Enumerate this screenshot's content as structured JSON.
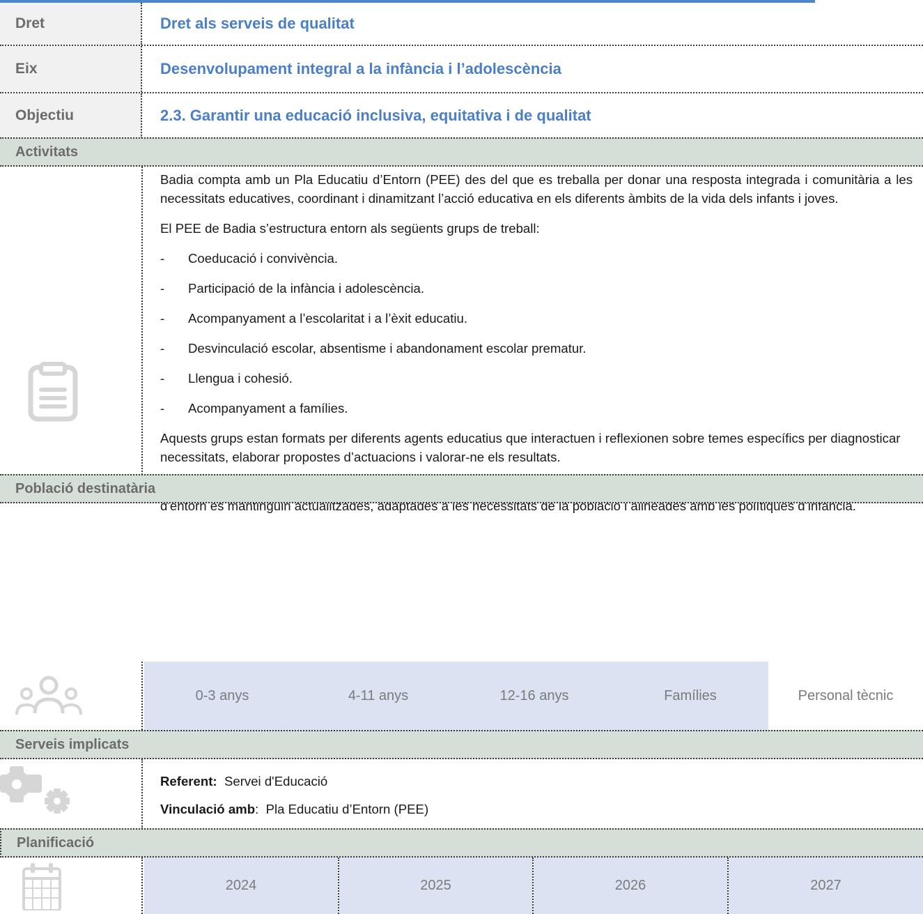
{
  "header": {
    "dret_label": "Dret",
    "dret_value": "Dret als serveis de qualitat",
    "eix_label": "Eix",
    "eix_value": "Desenvolupament integral a la infància i l’adolescència",
    "objectiu_label": "Objectiu",
    "objectiu_value": "2.3. Garantir una educació inclusiva, equitativa i de qualitat"
  },
  "activitats": {
    "title": "Activitats",
    "icon": "clipboard-icon",
    "intro": "Badia compta amb un Pla Educatiu d’Entorn (PEE) des del que es treballa per donar una resposta integrada i comunitària a les necessitats educatives, coordinant i dinamitzant l’acció educativa en els diferents àmbits de la vida dels infants i joves.",
    "groups_intro": "El PEE de Badia s’estructura entorn als següents grups de treball:",
    "groups": [
      "Coeducació i convivència.",
      "Participació de la infància i adolescència.",
      "Acompanyament a l’escolaritat i a l’èxit educatiu.",
      "Desvinculació escolar, absentisme i abandonament escolar prematur.",
      "Llengua i cohesió.",
      "Acompanyament a famílies."
    ],
    "para2": "Aquests grups estan formats per diferents agents educatius que interactuen i reflexionen sobre temes específics per diagnosticar necessitats, elaborar propostes d’actuacions i valorar-ne els resultats.",
    "para3": "Amb aquesta acció del PLIA es coordina amb el PEE per tal d’assegurar que les accions i estratègies definides en el pla educatiu d'entorn es mantinguin actualitzades, adaptades a les necessitats de la població i alineades amb les polítiques d’infància."
  },
  "poblacio": {
    "title": "Població destinatària",
    "icon": "people-group-icon",
    "items": [
      "0-3 anys",
      "4-11 anys",
      "12-16 anys",
      "Famílies",
      "Personal tècnic"
    ],
    "highlighted_count": 4,
    "highlight_color": "#dbe3f3"
  },
  "serveis": {
    "title": "Serveis implicats",
    "icon": "gears-icon",
    "referent_label": "Referent:",
    "referent_value": "Servei d'Educació",
    "vinculacio_label": "Vinculació amb",
    "vinculacio_value": "Pla Educatiu d’Entorn (PEE)"
  },
  "planificacio": {
    "title": "Planificació",
    "icon": "calendar-icon",
    "years": [
      "2024",
      "2025",
      "2026",
      "2027"
    ]
  },
  "colors": {
    "accent": "#4a7fc5",
    "section_bg": "#d5dfd8",
    "label_bg": "#f1f1f1"
  }
}
